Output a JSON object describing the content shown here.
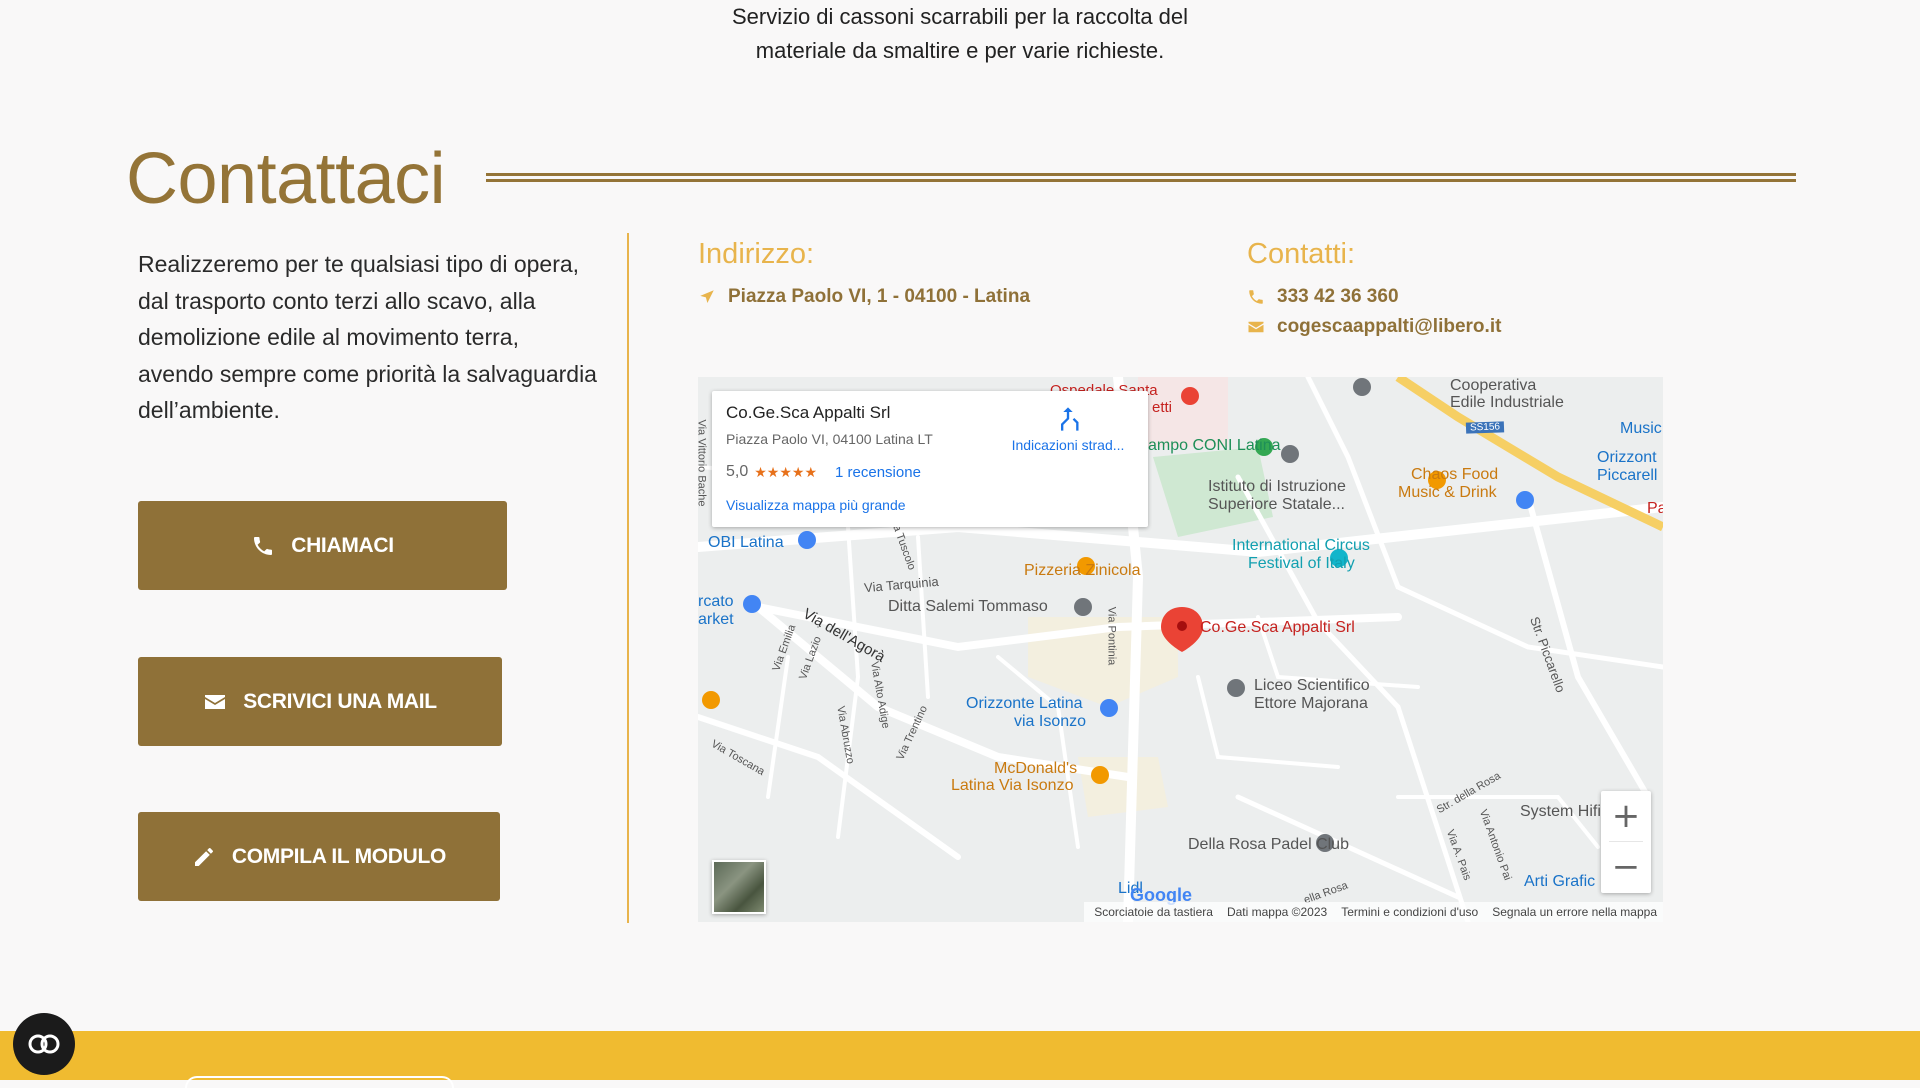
{
  "intro": {
    "line1": "Servizio di cassoni scarrabili per la raccolta del",
    "line2": "materiale da smaltire e per varie richieste."
  },
  "contact": {
    "title": "Contattaci",
    "lead": "Realizzeremo per te qualsiasi tipo di opera, dal trasporto conto terzi  allo scavo, alla demolizione edile al movimento terra, avendo sempre come priorità la salvaguardia dell’ambiente.",
    "buttons": {
      "call": "CHIAMACI",
      "mail": "SCRIVICI UNA MAIL",
      "form": "COMPILA IL MODULO"
    },
    "address_heading": "Indirizzo:",
    "address": "Piazza Paolo VI, 1 - 04100 - Latina",
    "contacts_heading": "Contatti:",
    "phone": "333 42 36 360",
    "email": "cogescaappalti@libero.it"
  },
  "map": {
    "card": {
      "name": "Co.Ge.Sca Appalti Srl",
      "address": "Piazza Paolo VI, 04100 Latina LT",
      "rating": "5,0",
      "stars": "★★★★★",
      "reviews": "1 recensione",
      "larger_map": "Visualizza mappa più grande",
      "directions": "Indicazioni strad..."
    },
    "labels": {
      "marker": "Co.Ge.Sca Appalti Srl",
      "obi": "OBI Latina",
      "cato1": "rcato",
      "cato2": "arket",
      "campo": "ampo CONI Latina",
      "ospedale1": "Ospedale Santa",
      "ospedale2": "etti",
      "istituto1": "Istituto di Istruzione",
      "istituto2": "Superiore Statale...",
      "coop1": "Cooperativa",
      "coop2": "Edile Industriale",
      "chaos1": "Chaos Food",
      "chaos2": "Music & Drink",
      "music": "Music",
      "orizz1": "Orizzont",
      "orizz2": "Piccarell",
      "pa": "Pa",
      "circus1": "International Circus",
      "circus2": "Festival of Italy",
      "pizzeria": "Pizzeria Zinicola",
      "salemi": "Ditta Salemi Tommaso",
      "liceo1": "Liceo Scientifico",
      "liceo2": "Ettore Majorana",
      "orizzonte1": "Orizzonte Latina",
      "orizzonte2": "via Isonzo",
      "mcd1": "McDonald's",
      "mcd2": "Latina Via Isonzo",
      "dellarosa": "Della Rosa Padel Club",
      "lidl": "Lidl",
      "system": "System Hifi S",
      "arti": "Arti Grafic",
      "ss156": "SS156",
      "via_tarquinia": "Via Tarquinia",
      "via_agora": "Via dell'Agorà",
      "via_piccarello": "Str. Piccarello",
      "via_pontinia": "Via Pontinia",
      "via_vittorio": "Via Vittorio Bache",
      "via_tuscolo": "Via Tuscolo",
      "via_emilia": "Via Emilia",
      "via_lazio": "Via Lazio",
      "via_abruzzo": "Via Abruzzo",
      "via_altoadige": "Via Alto Adige",
      "via_trentino": "Via Trentino",
      "via_toscana": "Via Toscana",
      "str_rosa": "Str. della Rosa",
      "via_paolo": "Via Antonio Pai",
      "via_apais": "Via A. Pais",
      "ella_rosa": "ella Rosa"
    },
    "zoom_in": "+",
    "zoom_out": "−",
    "google": "Google",
    "attribution": {
      "shortcuts": "Scorciatoie da tastiera",
      "data": "Dati mappa ©2023",
      "terms": "Termini e condizioni d'uso",
      "report": "Segnala un errore nella mappa"
    }
  }
}
